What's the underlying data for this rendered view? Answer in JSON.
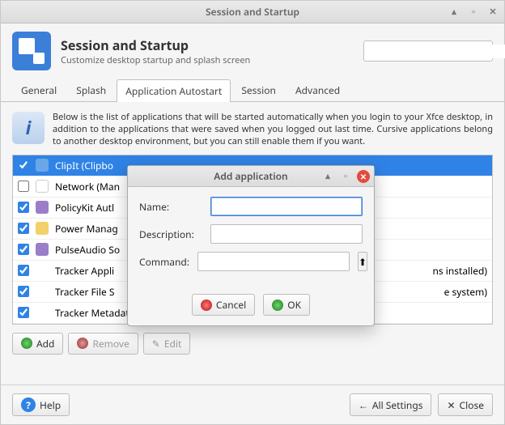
{
  "titlebar": {
    "title": "Session and Startup"
  },
  "header": {
    "title": "Session and Startup",
    "subtitle": "Customize desktop startup and splash screen"
  },
  "search": {
    "placeholder": ""
  },
  "tabs": [
    "General",
    "Splash",
    "Application Autostart",
    "Session",
    "Advanced"
  ],
  "active_tab": 2,
  "info_text": "Below is the list of applications that will be started automatically when you login to your Xfce desktop, in addition to the applications that were saved when you logged out last time. Cursive applications belong to another desktop environment, but you can still enable them if you want.",
  "list": [
    {
      "checked": true,
      "selected": true,
      "icon_color": "#6aa7e8",
      "label": "ClipIt (Clipbo"
    },
    {
      "checked": false,
      "selected": false,
      "icon_color": "#ffffff",
      "label": "Network (Man"
    },
    {
      "checked": true,
      "selected": false,
      "icon_color": "#9b7dc9",
      "label": "PolicyKit Autl"
    },
    {
      "checked": true,
      "selected": false,
      "icon_color": "#f3d06a",
      "label": "Power Manag"
    },
    {
      "checked": true,
      "selected": false,
      "icon_color": "#9b7dc9",
      "label": "PulseAudio So"
    },
    {
      "checked": true,
      "selected": false,
      "icon_color": "",
      "label": "Tracker Appli",
      "tail": "ns installed)"
    },
    {
      "checked": true,
      "selected": false,
      "icon_color": "",
      "label": "Tracker File S",
      "tail": "e system)"
    },
    {
      "checked": true,
      "selected": false,
      "icon_color": "",
      "label": "Tracker Metadata Extractor (Extracts metadata from local files)"
    }
  ],
  "toolbar": {
    "add": "Add",
    "remove": "Remove",
    "edit": "Edit"
  },
  "footer": {
    "help": "Help",
    "all_settings": "All Settings",
    "close": "Close"
  },
  "dialog": {
    "title": "Add application",
    "fields": {
      "name_label": "Name:",
      "description_label": "Description:",
      "command_label": "Command:",
      "name_value": "",
      "description_value": "",
      "command_value": ""
    },
    "buttons": {
      "cancel": "Cancel",
      "ok": "OK"
    }
  }
}
